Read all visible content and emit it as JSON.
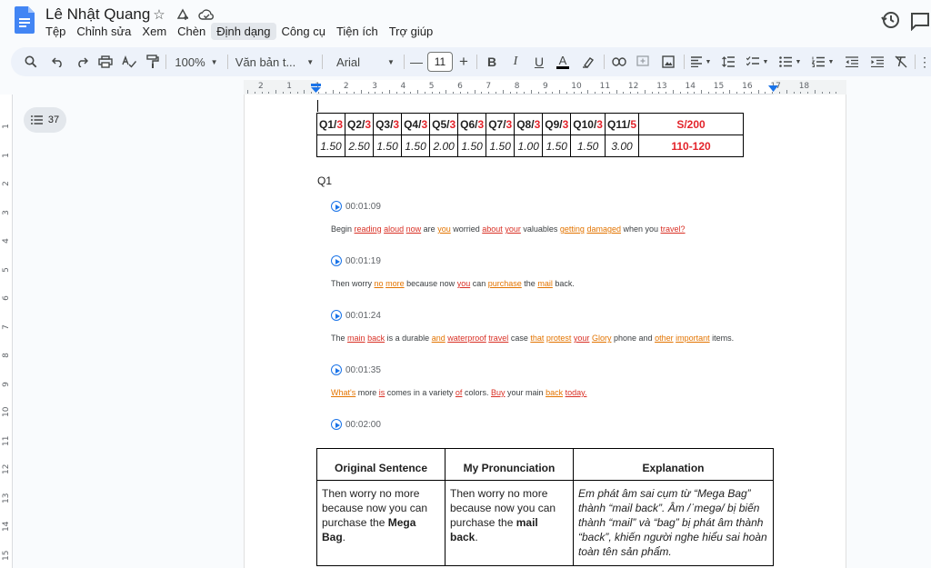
{
  "app": {
    "doc_title": "Lê Nhật Quang",
    "menu": [
      "Tệp",
      "Chỉnh sửa",
      "Xem",
      "Chèn",
      "Định dạng",
      "Công cụ",
      "Tiện ích",
      "Trợ giúp"
    ],
    "active_menu": "Định dạng"
  },
  "toolbar": {
    "zoom": "100%",
    "style": "Văn bản t...",
    "font": "Arial",
    "font_size": "11",
    "font_size_minus": "—",
    "font_size_plus": "+",
    "bold": "B",
    "italic": "I",
    "underline": "U",
    "text_color": "A"
  },
  "ruler": {
    "top_numbers": [
      "2",
      "1",
      "1",
      "2",
      "3",
      "4",
      "5",
      "6",
      "7",
      "8",
      "9",
      "10",
      "11",
      "12",
      "13",
      "14",
      "15",
      "16",
      "17",
      "18"
    ],
    "left_numbers": [
      "1",
      "1",
      "2",
      "3",
      "4",
      "5",
      "6",
      "7",
      "8",
      "9",
      "10",
      "11",
      "12",
      "13",
      "14",
      "15",
      "16"
    ]
  },
  "outline": {
    "count": "37"
  },
  "score_table": {
    "headers": [
      {
        "q": "Q1/",
        "max": "3"
      },
      {
        "q": "Q2/",
        "max": "3"
      },
      {
        "q": "Q3/",
        "max": "3"
      },
      {
        "q": "Q4/",
        "max": "3"
      },
      {
        "q": "Q5/",
        "max": "3"
      },
      {
        "q": "Q6/",
        "max": "3"
      },
      {
        "q": "Q7/",
        "max": "3"
      },
      {
        "q": "Q8/",
        "max": "3"
      },
      {
        "q": "Q9/",
        "max": "3"
      },
      {
        "q": "Q10/",
        "max": "3"
      },
      {
        "q": "Q11/",
        "max": "5"
      }
    ],
    "total_header": "S/200",
    "values": [
      "1.50",
      "2.50",
      "1.50",
      "1.50",
      "2.00",
      "1.50",
      "1.50",
      "1.00",
      "1.50",
      "1.50",
      "3.00"
    ],
    "total_value": "110-120"
  },
  "section_title": "Q1",
  "timestamps": [
    "00:01:09",
    "00:01:19",
    "00:01:24",
    "00:01:35",
    "00:02:00"
  ],
  "sentences": [
    "Begin reading aloud now are you worried about your valuables getting damaged when you travel?",
    "Then worry no more because now you can purchase the mail back.",
    "The main back is a durable and waterproof travel case that protest your Glory phone and other important items.",
    "What's more is comes in a variety of colors. Buy your main back today."
  ],
  "explanation_table": {
    "headers": [
      "Original Sentence",
      "My Pronunciation",
      "Explanation"
    ],
    "row": {
      "original_pre": "Then worry no more because now you can purchase the ",
      "original_bold": "Mega Bag",
      "original_post": ".",
      "mine_pre": "Then worry no more because now you can purchase the ",
      "mine_bold": "mail back",
      "mine_post": ".",
      "explanation": "Em phát âm sai cụm từ “Mega Bag” thành “mail back”. Âm /ˈmegə/ bị biến thành “mail” và “bag” bị phát âm thành “back”, khiến người nghe hiểu sai hoàn toàn tên sản phẩm."
    }
  },
  "colors": {
    "accent": "#1a73e8",
    "error": "#e3242b",
    "toolbar_bg": "#edf2fa"
  }
}
